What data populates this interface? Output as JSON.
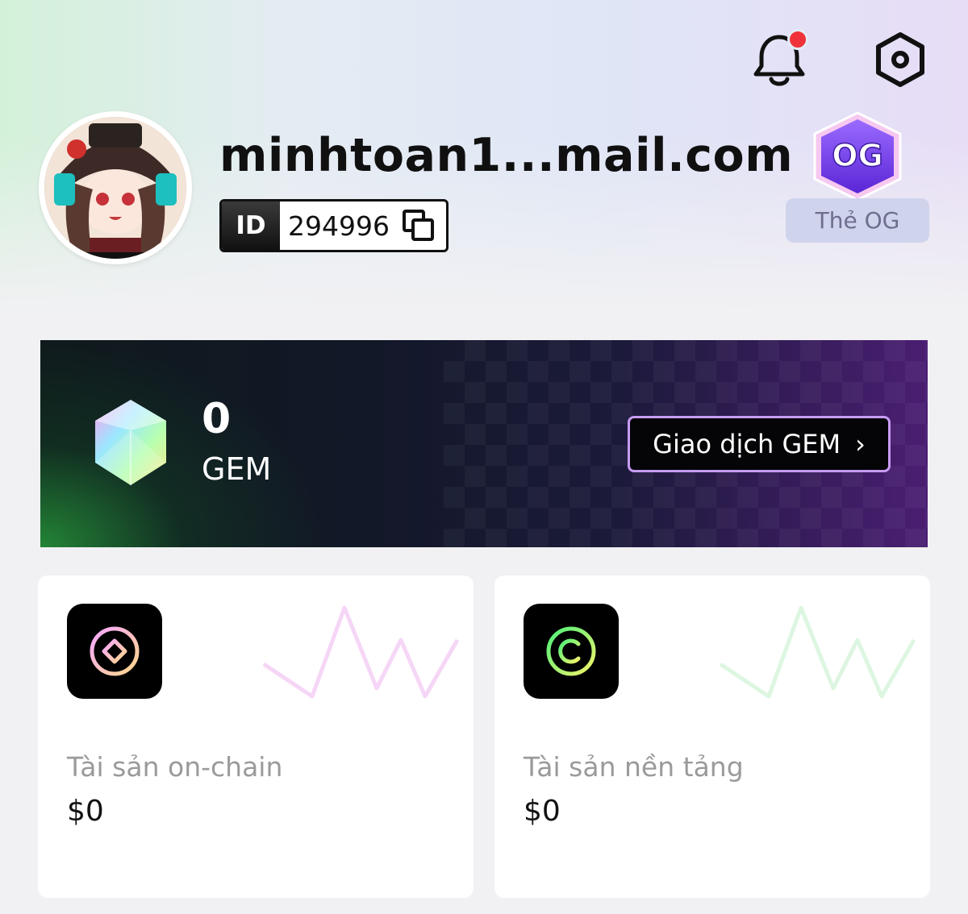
{
  "header": {
    "notification_icon": "bell-icon",
    "has_unread_notification": true,
    "settings_icon": "gear-icon"
  },
  "profile": {
    "username": "minhtoan1...mail.com",
    "id_label": "ID",
    "id_value": "294996",
    "copy_icon": "copy-icon",
    "badge_text": "OG",
    "badge_label": "Thẻ OG"
  },
  "gem": {
    "count": "0",
    "unit": "GEM",
    "trade_button_label": "Giao dịch GEM",
    "trade_button_chevron": "›"
  },
  "assets": [
    {
      "label": "Tài sản on-chain",
      "value": "$0",
      "icon": "onchain-diamond-icon"
    },
    {
      "label": "Tài sản nền tảng",
      "value": "$0",
      "icon": "platform-c-icon"
    }
  ],
  "colors": {
    "notification_dot": "#f0333a",
    "trade_button_border": "#c79cf5",
    "badge_purple": "#7a3ee6"
  }
}
